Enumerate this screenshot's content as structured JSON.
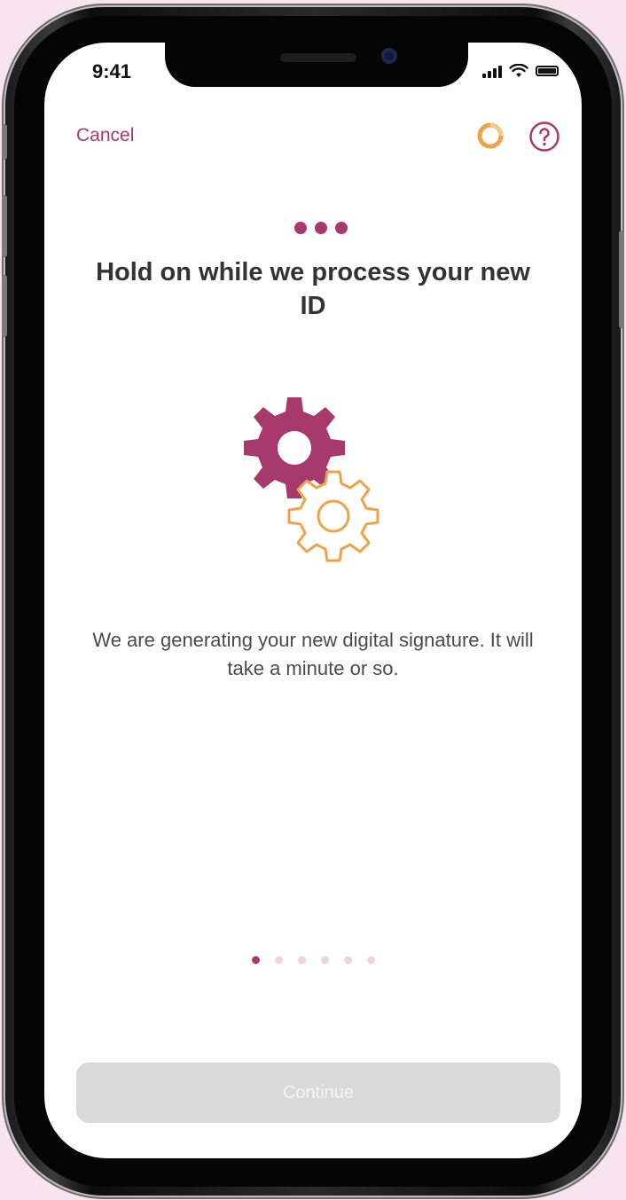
{
  "status_bar": {
    "time": "9:41"
  },
  "header": {
    "cancel_label": "Cancel"
  },
  "main": {
    "title": "Hold on while we process your new ID",
    "message": "We are generating your new digital signature. It will take a minute or so."
  },
  "pager": {
    "count": 6,
    "active_index": 0
  },
  "footer": {
    "continue_label": "Continue"
  },
  "colors": {
    "accent": "#a8396d",
    "secondary": "#f0a24a",
    "disabled_button": "#d9d9d9",
    "background": "#f7e4ee"
  },
  "icons": [
    "loading-ring-icon",
    "help-icon",
    "ellipsis-icon",
    "gears-icon"
  ]
}
